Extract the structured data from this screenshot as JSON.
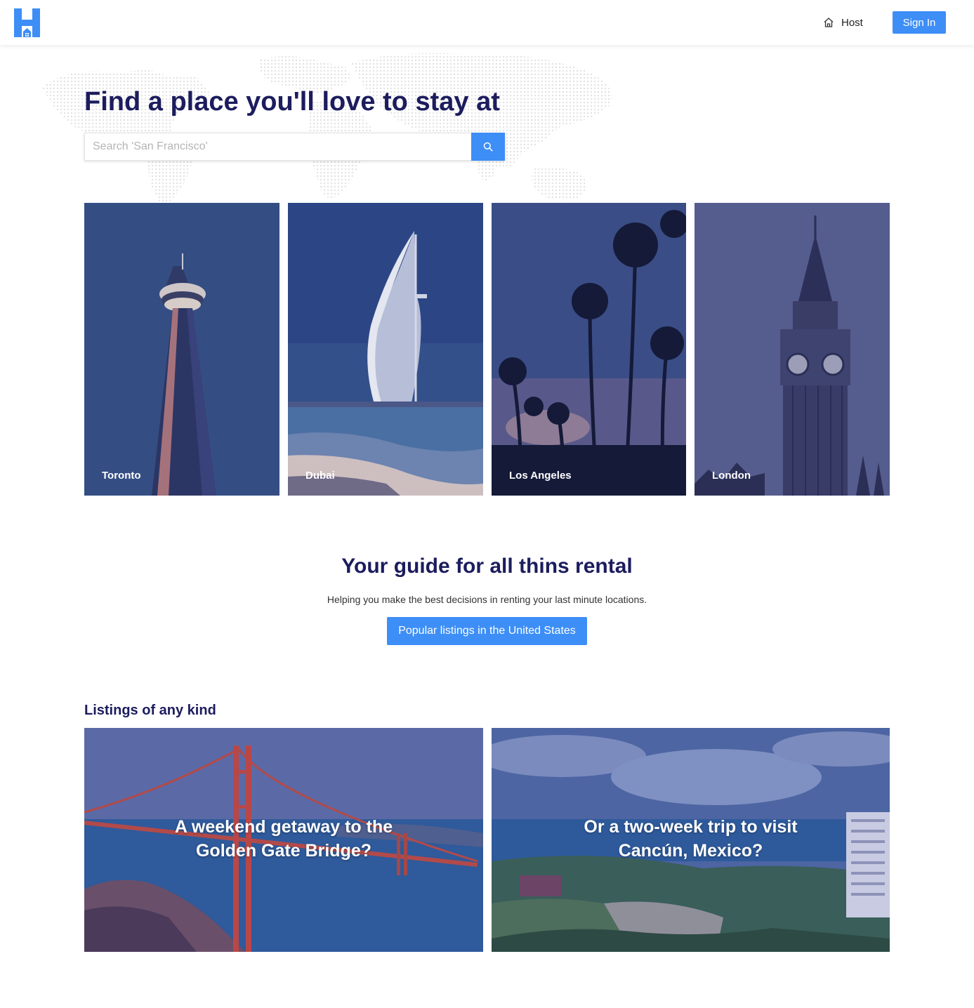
{
  "header": {
    "host_label": "Host",
    "signin_label": "Sign In"
  },
  "hero": {
    "title": "Find a place you'll love to stay at",
    "search_placeholder": "Search 'San Francisco'"
  },
  "cities": [
    {
      "name": "Toronto"
    },
    {
      "name": "Dubai"
    },
    {
      "name": "Los Angeles"
    },
    {
      "name": "London"
    }
  ],
  "guide": {
    "title": "Your guide for all thins rental",
    "subtitle": "Helping you make the best decisions in renting your last minute locations.",
    "button_label": "Popular listings in the United States"
  },
  "listings": {
    "title": "Listings of any kind",
    "items": [
      {
        "line1": "A weekend getaway to the",
        "line2": "Golden Gate Bridge?"
      },
      {
        "line1": "Or a two-week trip to visit",
        "line2": "Cancún, Mexico?"
      }
    ]
  },
  "colors": {
    "brand_blue": "#3d8ef6",
    "title_navy": "#1c1c5e"
  }
}
